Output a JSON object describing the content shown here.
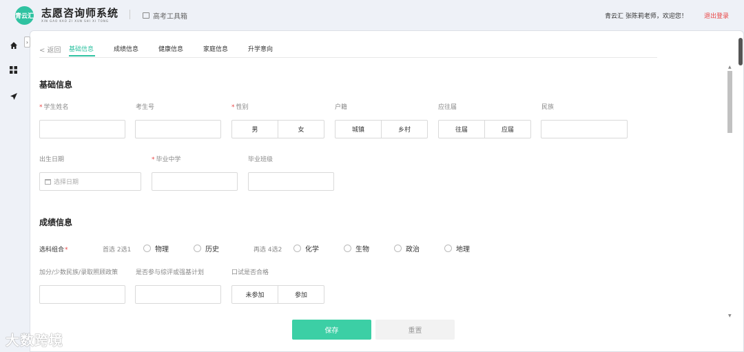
{
  "header": {
    "logo_text": "青云汇",
    "brand_title": "志愿咨询师系统",
    "brand_subtitle": "XIN GAO KAO ZI XUN SHI XI TONG",
    "tools_label": "高考工具箱",
    "welcome": "青云汇 张陈莉老师，欢迎您！",
    "logout": "退出登录"
  },
  "sidebar": {
    "items": [
      "home-icon",
      "apps-icon",
      "send-icon"
    ],
    "collapse_glyph": "›"
  },
  "tabs": {
    "back": "< 返回",
    "items": [
      "基础信息",
      "成绩信息",
      "健康信息",
      "家庭信息",
      "升学意向"
    ],
    "active": 0
  },
  "basic": {
    "title": "基础信息",
    "name_label": "学生姓名",
    "exam_no_label": "考生号",
    "gender_label": "性别",
    "gender_options": [
      "男",
      "女"
    ],
    "hukou_label": "户籍",
    "hukou_options": [
      "城镇",
      "乡村"
    ],
    "grad_type_label": "应往届",
    "grad_type_options": [
      "往届",
      "应届"
    ],
    "ethnicity_label": "民族",
    "birth_label": "出生日期",
    "birth_placeholder": "选择日期",
    "school_label": "毕业中学",
    "class_label": "毕业班级"
  },
  "scores": {
    "title": "成绩信息",
    "combo_label": "选科组合",
    "first_choice_label": "首选 2选1",
    "first_options": [
      "物理",
      "历史"
    ],
    "second_choice_label": "再选 4选2",
    "second_options": [
      "化学",
      "生物",
      "政治",
      "地理"
    ],
    "bonus_label": "加分/少数民族/录取照顾政策",
    "plan_label": "是否参与综评或强基计划",
    "oral_label": "口试是否合格",
    "oral_options": [
      "未参加",
      "参加"
    ]
  },
  "actions": {
    "save": "保存",
    "reset": "重置"
  },
  "watermark": "大数跨境",
  "colors": {
    "accent": "#2fc2a1",
    "danger": "#e94545",
    "save": "#3ccfa5"
  }
}
